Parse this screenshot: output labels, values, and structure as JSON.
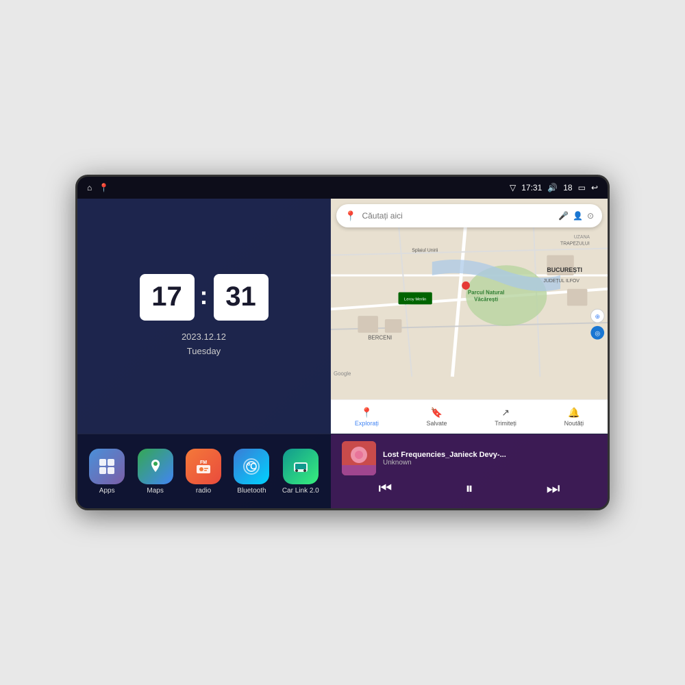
{
  "device": {
    "status_bar": {
      "left_icons": [
        "home",
        "maps"
      ],
      "time": "17:31",
      "signal_icon": "▽",
      "volume_icon": "🔊",
      "battery_level": "18",
      "battery_icon": "▭",
      "back_icon": "↩"
    }
  },
  "clock": {
    "hour": "17",
    "minute": "31",
    "date": "2023.12.12",
    "day": "Tuesday"
  },
  "map": {
    "search_placeholder": "Căutați aici",
    "bottom_items": [
      {
        "label": "Explorați",
        "active": true
      },
      {
        "label": "Salvate",
        "active": false
      },
      {
        "label": "Trimiteți",
        "active": false
      },
      {
        "label": "Noutăți",
        "active": false
      }
    ],
    "location_label": "Parcul Natural Văcărești",
    "city_label": "BUCUREȘTI",
    "district_label": "JUDEȚUL ILFOV",
    "area1": "BERCENI",
    "google_logo": "Google"
  },
  "apps": [
    {
      "id": "apps",
      "label": "Apps",
      "icon_class": "apps-icon",
      "icon": "⊞"
    },
    {
      "id": "maps",
      "label": "Maps",
      "icon_class": "maps-icon",
      "icon": "📍"
    },
    {
      "id": "radio",
      "label": "radio",
      "icon_class": "radio-icon",
      "icon": "📻"
    },
    {
      "id": "bluetooth",
      "label": "Bluetooth",
      "icon_class": "bluetooth-icon",
      "icon": "⌾"
    },
    {
      "id": "carlink",
      "label": "Car Link 2.0",
      "icon_class": "carlink-icon",
      "icon": "🚗"
    }
  ],
  "music": {
    "title": "Lost Frequencies_Janieck Devy-...",
    "artist": "Unknown",
    "prev_label": "⏮",
    "play_label": "⏸",
    "next_label": "⏭"
  }
}
